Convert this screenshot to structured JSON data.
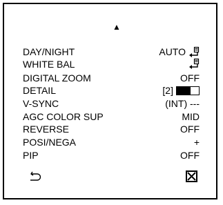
{
  "menu": {
    "scroll_up_icon": "triangle-up",
    "items": [
      {
        "label": "DAY/NIGHT",
        "value": "AUTO",
        "icon": "enter-icon"
      },
      {
        "label": "WHITE BAL",
        "value": "",
        "icon": "enter-icon"
      },
      {
        "label": "DIGITAL ZOOM",
        "value": "OFF"
      },
      {
        "label": "DETAIL",
        "value": "[2]",
        "level": 0.62
      },
      {
        "label": "V-SYNC",
        "value": "(INT) ---"
      },
      {
        "label": "AGC COLOR SUP",
        "value": "MID"
      },
      {
        "label": "REVERSE",
        "value": "OFF"
      },
      {
        "label": "POSI/NEGA",
        "value": "+"
      },
      {
        "label": "PIP",
        "value": "OFF"
      }
    ],
    "return_icon": "return-icon",
    "close_icon": "close-box-icon"
  }
}
